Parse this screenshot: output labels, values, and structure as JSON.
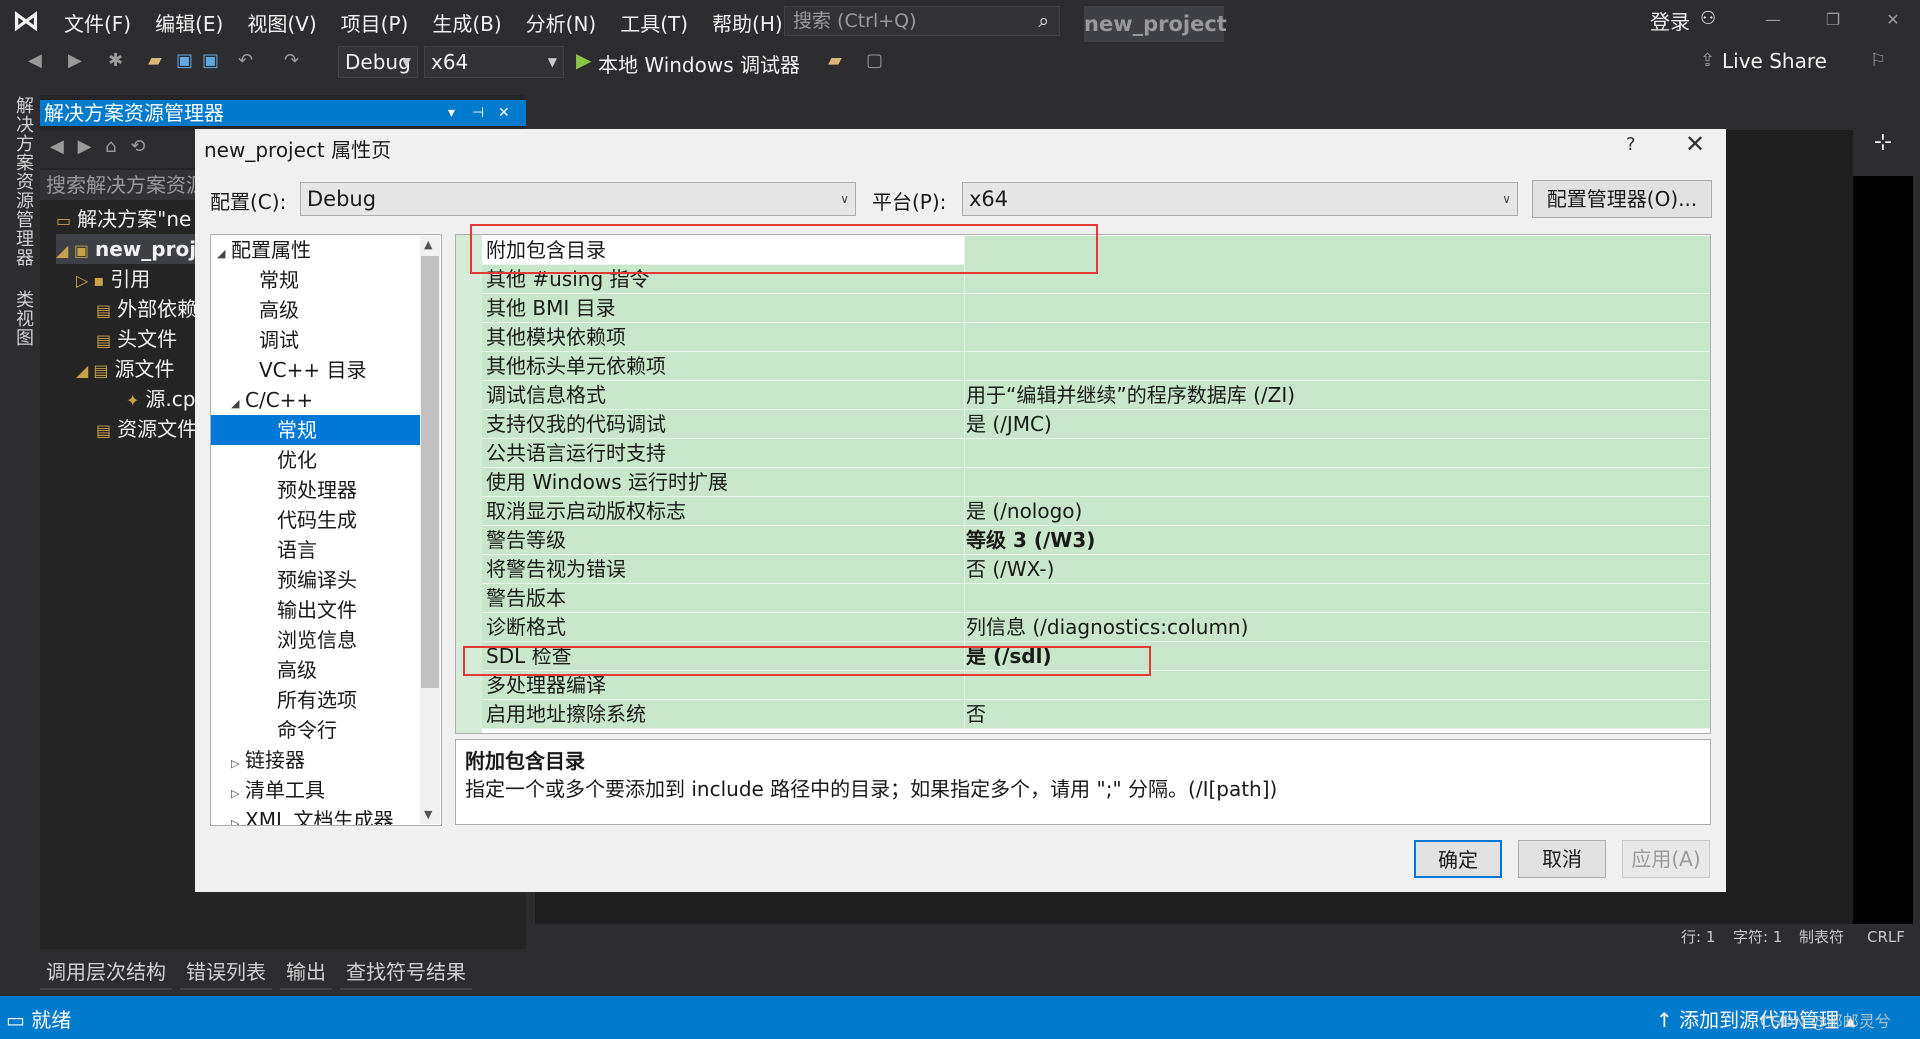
{
  "menu": {
    "items": [
      "文件(F)",
      "编辑(E)",
      "视图(V)",
      "项目(P)",
      "生成(B)",
      "分析(N)",
      "工具(T)",
      "帮助(H)"
    ],
    "search_placeholder": "搜索 (Ctrl+Q)",
    "project_name": "new_project",
    "login": "登录"
  },
  "toolbar": {
    "config": "Debug",
    "platform": "x64",
    "debugger": "本地 Windows 调试器",
    "live_share": "Live Share"
  },
  "left_tabs": [
    "解决方案资源管理器",
    "类视图"
  ],
  "solution_explorer": {
    "title": "解决方案资源管理器",
    "search_placeholder": "搜索解决方案资源",
    "tree": [
      {
        "label": "解决方案\"ne"
      },
      {
        "label": "new_proj"
      },
      {
        "label": "引用"
      },
      {
        "label": "外部依赖"
      },
      {
        "label": "头文件"
      },
      {
        "label": "源文件"
      },
      {
        "label": "源.cp"
      },
      {
        "label": "资源文件"
      }
    ]
  },
  "dialog": {
    "title": "new_project 属性页",
    "help": "?",
    "config_label": "配置(C):",
    "config_value": "Debug",
    "platform_label": "平台(P):",
    "platform_value": "x64",
    "config_manager": "配置管理器(O)...",
    "tree": [
      {
        "label": "配置属性",
        "arrow": "◢"
      },
      {
        "label": "常规"
      },
      {
        "label": "高级"
      },
      {
        "label": "调试"
      },
      {
        "label": "VC++ 目录"
      },
      {
        "label": "C/C++",
        "arrow": "◢"
      },
      {
        "label": "常规",
        "selected": true
      },
      {
        "label": "优化"
      },
      {
        "label": "预处理器"
      },
      {
        "label": "代码生成"
      },
      {
        "label": "语言"
      },
      {
        "label": "预编译头"
      },
      {
        "label": "输出文件"
      },
      {
        "label": "浏览信息"
      },
      {
        "label": "高级"
      },
      {
        "label": "所有选项"
      },
      {
        "label": "命令行"
      },
      {
        "label": "链接器",
        "arrow": "▷"
      },
      {
        "label": "清单工具",
        "arrow": "▷"
      },
      {
        "label": "XML 文档生成器",
        "arrow": "▷"
      }
    ],
    "properties": [
      {
        "key": "附加包含目录",
        "value": ""
      },
      {
        "key": "其他 #using 指令",
        "value": ""
      },
      {
        "key": "其他 BMI 目录",
        "value": ""
      },
      {
        "key": "其他模块依赖项",
        "value": ""
      },
      {
        "key": "其他标头单元依赖项",
        "value": ""
      },
      {
        "key": "调试信息格式",
        "value": "用于“编辑并继续”的程序数据库 (/ZI)"
      },
      {
        "key": "支持仅我的代码调试",
        "value": "是 (/JMC)"
      },
      {
        "key": "公共语言运行时支持",
        "value": ""
      },
      {
        "key": "使用 Windows 运行时扩展",
        "value": ""
      },
      {
        "key": "取消显示启动版权标志",
        "value": "是 (/nologo)"
      },
      {
        "key": "警告等级",
        "value": "等级 3 (/W3)",
        "bold": true
      },
      {
        "key": "将警告视为错误",
        "value": "否 (/WX-)"
      },
      {
        "key": "警告版本",
        "value": ""
      },
      {
        "key": "诊断格式",
        "value": "列信息 (/diagnostics:column)"
      },
      {
        "key": "SDL 检查",
        "value": "是 (/sdl)",
        "bold": true
      },
      {
        "key": "多处理器编译",
        "value": ""
      },
      {
        "key": "启用地址擦除系统",
        "value": "否"
      }
    ],
    "description": {
      "title": "附加包含目录",
      "text": "指定一个或多个要添加到 include 路径中的目录；如果指定多个，请用 \";\" 分隔。(/I[path])"
    },
    "buttons": {
      "ok": "确定",
      "cancel": "取消",
      "apply": "应用(A)"
    }
  },
  "editor_status": {
    "line": "行: 1",
    "char": "字符: 1",
    "tab": "制表符",
    "eol": "CRLF"
  },
  "bottom_tabs": [
    "调用层次结构",
    "错误列表",
    "输出",
    "查找符号结果"
  ],
  "status": {
    "left": "就绪",
    "right": "添加到源代码管理"
  },
  "watermark": "CSDN @邮邮灵兮"
}
